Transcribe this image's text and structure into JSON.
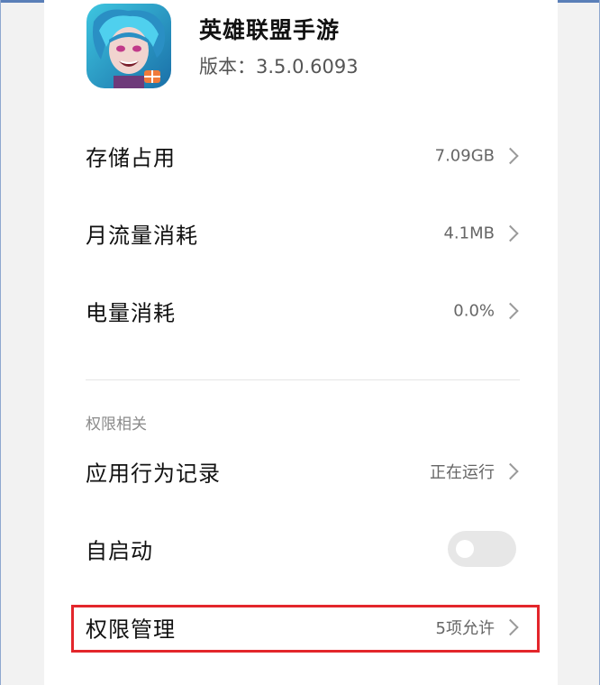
{
  "app": {
    "name": "英雄联盟手游",
    "version": "版本：3.5.0.6093",
    "icon": "game-character-icon"
  },
  "usage": [
    {
      "label": "存储占用",
      "value": "7.09GB"
    },
    {
      "label": "月流量消耗",
      "value": "4.1MB"
    },
    {
      "label": "电量消耗",
      "value": "0.0%"
    }
  ],
  "permissions": {
    "section_title": "权限相关",
    "behavior": {
      "label": "应用行为记录",
      "value": "正在运行"
    },
    "autostart": {
      "label": "自启动",
      "enabled": false
    },
    "manage": {
      "label": "权限管理",
      "value": "5项允许"
    }
  },
  "colors": {
    "highlight": "#e3262b",
    "toggle_off": "#e7e7e7"
  }
}
